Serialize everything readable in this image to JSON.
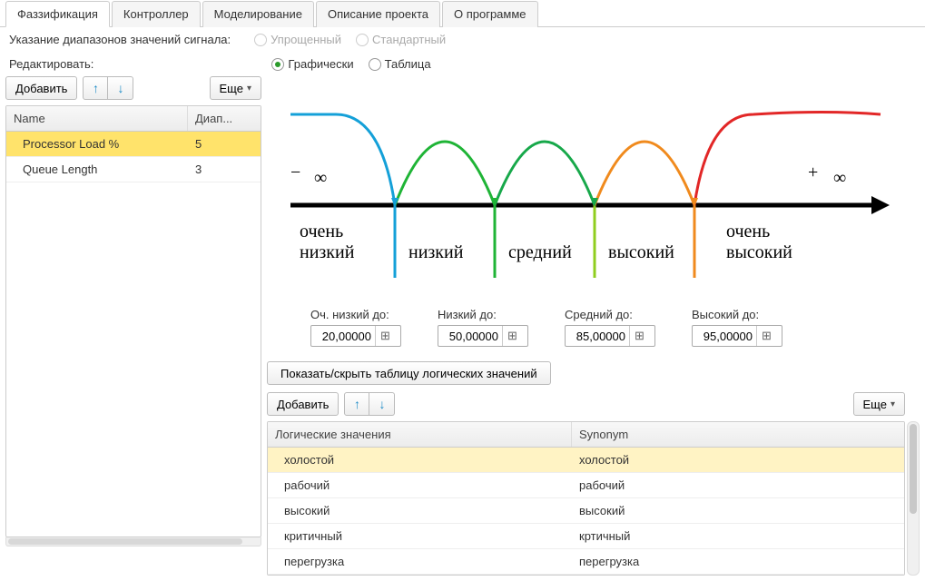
{
  "tabs": [
    "Фаззификация",
    "Контроллер",
    "Моделирование",
    "Описание проекта",
    "О программе"
  ],
  "active_tab": 0,
  "signal_ranges_label": "Указание диапазонов значений сигнала:",
  "range_mode": {
    "simplified": "Упрощенный",
    "standard": "Стандартный"
  },
  "edit_label": "Редактировать:",
  "edit_mode": {
    "graphic": "Графически",
    "table": "Таблица"
  },
  "buttons": {
    "add": "Добавить",
    "more": "Еще"
  },
  "left_table": {
    "headers": {
      "name": "Name",
      "diap": "Диап..."
    },
    "rows": [
      {
        "name": "Processor Load %",
        "diap": "5",
        "selected": true
      },
      {
        "name": "Queue Length",
        "diap": "3",
        "selected": false
      }
    ]
  },
  "chart_data": {
    "type": "fuzzy-membership",
    "segments": [
      {
        "label": "очень низкий",
        "color": "#14a0d8"
      },
      {
        "label": "низкий",
        "color": "#1fb436"
      },
      {
        "label": "средний",
        "color": "#17a84a"
      },
      {
        "label": "высокий",
        "color": "#f08a1d"
      },
      {
        "label": "очень высокий",
        "color": "#e22727"
      }
    ],
    "left_symbol": "−∞",
    "right_symbol": "+∞"
  },
  "ranges": [
    {
      "label": "Оч. низкий до:",
      "value": "20,00000"
    },
    {
      "label": "Низкий до:",
      "value": "50,00000"
    },
    {
      "label": "Средний до:",
      "value": "85,00000"
    },
    {
      "label": "Высокий до:",
      "value": "95,00000"
    }
  ],
  "toggle_button": "Показать/скрыть таблицу логических значений",
  "logic_table": {
    "headers": {
      "logic": "Логические значения",
      "synonym": "Synonym"
    },
    "rows": [
      {
        "logic": "холостой",
        "synonym": "холостой",
        "selected": true
      },
      {
        "logic": "рабочий",
        "synonym": "рабочий"
      },
      {
        "logic": "высокий",
        "synonym": "высокий"
      },
      {
        "logic": "критичный",
        "synonym": "кртичный"
      },
      {
        "logic": "перегрузка",
        "synonym": "перегрузка"
      }
    ]
  }
}
